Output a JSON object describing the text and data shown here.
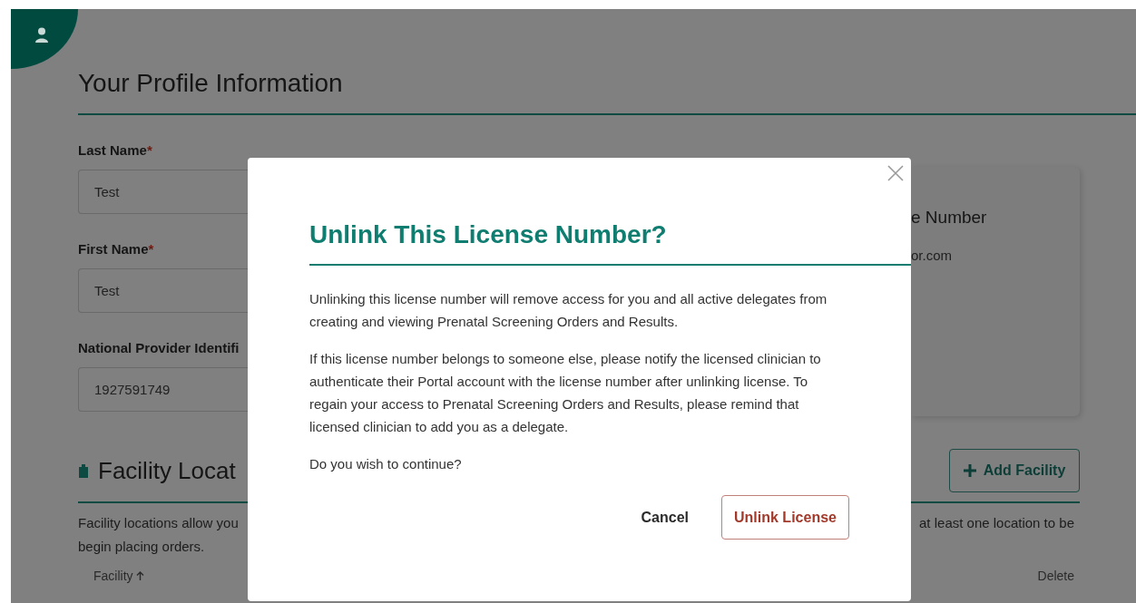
{
  "page": {
    "title": "Your Profile Information",
    "fields": [
      {
        "label": "Last Name",
        "required_mark": "*",
        "value": "Test"
      },
      {
        "label": "First Name",
        "required_mark": "*",
        "value": "Test"
      },
      {
        "label": "National Provider Identifi",
        "value": "1927591749"
      }
    ],
    "license_card": {
      "title": "e Number",
      "text": "or.com"
    },
    "facility": {
      "title": "Facility Locat",
      "add_button": "Add Facility",
      "description_left": [
        "Facility locations allow you",
        "begin placing orders."
      ],
      "description_right": "at least one location to be",
      "columns": [
        {
          "label": "Facility",
          "sorted": true
        },
        {
          "label": "Delete",
          "sorted": false
        }
      ]
    }
  },
  "dialog": {
    "title": "Unlink This License Number?",
    "paragraphs": [
      "Unlinking this license number will remove access for you and all active delegates from creating and viewing Prenatal Screening Orders and Results.",
      "If this license number belongs to someone else, please notify the licensed clinician to authenticate their Portal account with the license number after unlinking license. To regain your access to Prenatal Screening Orders and Results, please remind that licensed clinician to add you as a delegate.",
      "Do you wish to continue?"
    ],
    "buttons": [
      {
        "label": "Cancel",
        "kind": "text"
      },
      {
        "label": "Unlink License",
        "kind": "outlined"
      }
    ]
  }
}
